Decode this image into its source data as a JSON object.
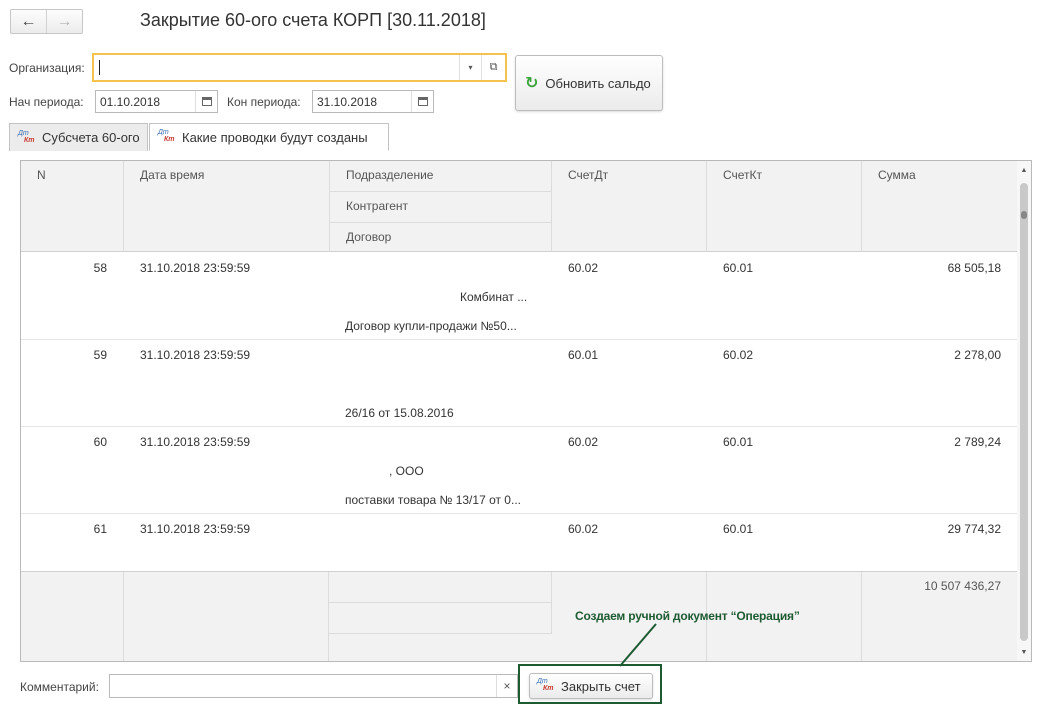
{
  "toolbar": {
    "back_icon": "←",
    "forward_icon": "→"
  },
  "title": "Закрытие 60-ого счета КОРП [30.11.2018]",
  "org": {
    "label": "Организация:",
    "value": "",
    "dropdown_icon": "▾",
    "open_icon": "⧉"
  },
  "refresh_button": {
    "label": "Обновить сальдо",
    "icon": "↻"
  },
  "period": {
    "start_label": "Нач периода:",
    "start_value": "01.10.2018",
    "end_label": "Кон периода:",
    "end_value": "31.10.2018"
  },
  "tabs": [
    {
      "label": "Субсчета 60-ого",
      "active": false
    },
    {
      "label": "Какие проводки будут созданы",
      "active": true
    }
  ],
  "dtkt_icon": {
    "top": "Дт",
    "bottom": "Кт"
  },
  "table": {
    "headers": {
      "n": "N",
      "datetime": "Дата время",
      "division": "Подразделение",
      "counterparty": "Контрагент",
      "contract": "Договор",
      "debit": "СчетДт",
      "credit": "СчетКт",
      "sum": "Сумма"
    },
    "rows": [
      {
        "n": "58",
        "datetime": "31.10.2018 23:59:59",
        "debit": "60.02",
        "credit": "60.01",
        "sum": "68 505,18",
        "counterparty": "Комбинат ...",
        "contract": "Договор купли-продажи №50..."
      },
      {
        "n": "59",
        "datetime": "31.10.2018 23:59:59",
        "debit": "60.01",
        "credit": "60.02",
        "sum": "2 278,00",
        "counterparty": "",
        "contract": "26/16 от 15.08.2016"
      },
      {
        "n": "60",
        "datetime": "31.10.2018 23:59:59",
        "debit": "60.02",
        "credit": "60.01",
        "sum": "2 789,24",
        "counterparty": ", ООО",
        "contract": "поставки товара № 13/17 от 0..."
      },
      {
        "n": "61",
        "datetime": "31.10.2018 23:59:59",
        "debit": "60.02",
        "credit": "60.01",
        "sum": "29 774,32",
        "counterparty": "",
        "contract": ""
      }
    ],
    "total": "10 507 436,27"
  },
  "annotation": "Создаем ручной документ “Операция”",
  "comment": {
    "label": "Комментарий:",
    "value": "",
    "clear_icon": "×"
  },
  "close_button": {
    "label": "Закрыть счет"
  },
  "colors": {
    "accent_field_border": "#f5c24f",
    "annotation": "#1e5b32",
    "refresh_icon": "#3aa33a"
  }
}
